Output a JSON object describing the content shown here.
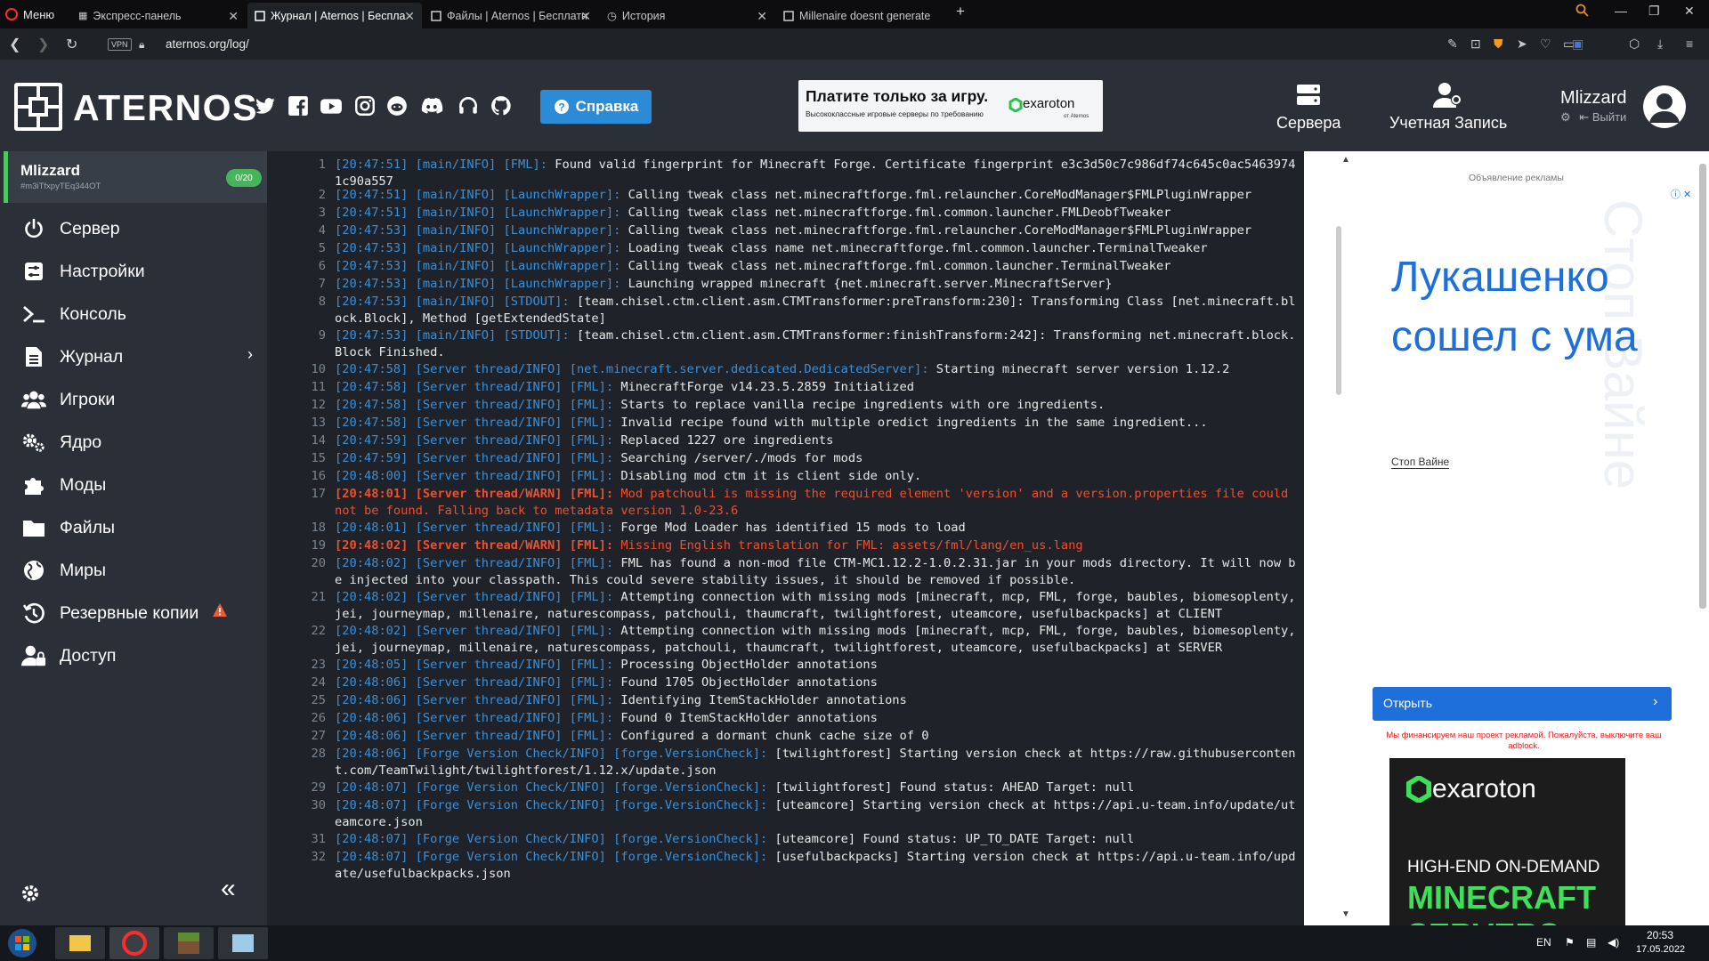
{
  "browser": {
    "menu_label": "Меню",
    "tabs": [
      {
        "label": "Экспресс-панель",
        "active": false
      },
      {
        "label": "Журнал | Aternos | Беспла",
        "active": true
      },
      {
        "label": "Файлы | Aternos | Бесплатн",
        "active": false
      },
      {
        "label": "История",
        "active": false
      },
      {
        "label": "Millenaire doesnt generate",
        "active": false
      }
    ],
    "vpn_label": "VPN",
    "url": "aternos.org/log/"
  },
  "header": {
    "logo_text": "ATERNOS",
    "help_label": "Справка",
    "promo": {
      "headline": "Платите только за игру.",
      "subline": "Высококлассные игровые серверы по требованию",
      "brand": "exaroton",
      "brand_sub": "от Aternos"
    },
    "nav": [
      {
        "label": "Сервера",
        "icon": "servers-icon"
      },
      {
        "label": "Учетная Запись",
        "icon": "account-icon"
      }
    ],
    "user": {
      "name": "Mlizzard",
      "logout": "Выйти"
    }
  },
  "sidebar": {
    "server_name": "Mlizzard",
    "server_id": "#m3iTfxpyTEq344OT",
    "players_badge": "0/20",
    "items": [
      {
        "label": "Сервер",
        "icon": "power-icon"
      },
      {
        "label": "Настройки",
        "icon": "sliders-icon"
      },
      {
        "label": "Консоль",
        "icon": "terminal-icon"
      },
      {
        "label": "Журнал",
        "icon": "document-icon"
      },
      {
        "label": "Игроки",
        "icon": "users-icon"
      },
      {
        "label": "Ядро",
        "icon": "cogs-icon"
      },
      {
        "label": "Моды",
        "icon": "puzzle-icon"
      },
      {
        "label": "Файлы",
        "icon": "folder-icon"
      },
      {
        "label": "Миры",
        "icon": "globe-icon"
      },
      {
        "label": "Резервные копии",
        "icon": "history-icon"
      },
      {
        "label": "Доступ",
        "icon": "user-lock-icon"
      }
    ]
  },
  "log": {
    "lines": [
      {
        "n": "1",
        "p": "[20:47:51] [main/INFO] [FML]:",
        "m": "Found valid fingerprint for Minecraft Forge. Certificate fingerprint e3c3d50c7c986df74c645c0ac54639741c90a557",
        "warn": false
      },
      {
        "n": "2",
        "p": "[20:47:51] [main/INFO] [LaunchWrapper]:",
        "m": "Calling tweak class net.minecraftforge.fml.relauncher.CoreModManager$FMLPluginWrapper",
        "warn": false
      },
      {
        "n": "3",
        "p": "[20:47:51] [main/INFO] [LaunchWrapper]:",
        "m": "Calling tweak class net.minecraftforge.fml.common.launcher.FMLDeobfTweaker",
        "warn": false
      },
      {
        "n": "4",
        "p": "[20:47:53] [main/INFO] [LaunchWrapper]:",
        "m": "Calling tweak class net.minecraftforge.fml.relauncher.CoreModManager$FMLPluginWrapper",
        "warn": false
      },
      {
        "n": "5",
        "p": "[20:47:53] [main/INFO] [LaunchWrapper]:",
        "m": "Loading tweak class name net.minecraftforge.fml.common.launcher.TerminalTweaker",
        "warn": false
      },
      {
        "n": "6",
        "p": "[20:47:53] [main/INFO] [LaunchWrapper]:",
        "m": "Calling tweak class net.minecraftforge.fml.common.launcher.TerminalTweaker",
        "warn": false
      },
      {
        "n": "7",
        "p": "[20:47:53] [main/INFO] [LaunchWrapper]:",
        "m": "Launching wrapped minecraft {net.minecraft.server.MinecraftServer}",
        "warn": false
      },
      {
        "n": "8",
        "p": "[20:47:53] [main/INFO] [STDOUT]:",
        "m": "[team.chisel.ctm.client.asm.CTMTransformer:preTransform:230]: Transforming Class [net.minecraft.block.Block], Method [getExtendedState]",
        "warn": false
      },
      {
        "n": "9",
        "p": "[20:47:53] [main/INFO] [STDOUT]:",
        "m": "[team.chisel.ctm.client.asm.CTMTransformer:finishTransform:242]: Transforming net.minecraft.block.Block Finished.",
        "warn": false
      },
      {
        "n": "10",
        "p": "[20:47:58] [Server thread/INFO] [net.minecraft.server.dedicated.DedicatedServer]:",
        "m": "Starting minecraft server version 1.12.2",
        "warn": false
      },
      {
        "n": "11",
        "p": "[20:47:58] [Server thread/INFO] [FML]:",
        "m": "MinecraftForge v14.23.5.2859 Initialized",
        "warn": false
      },
      {
        "n": "12",
        "p": "[20:47:58] [Server thread/INFO] [FML]:",
        "m": "Starts to replace vanilla recipe ingredients with ore ingredients.",
        "warn": false
      },
      {
        "n": "13",
        "p": "[20:47:58] [Server thread/INFO] [FML]:",
        "m": "Invalid recipe found with multiple oredict ingredients in the same ingredient...",
        "warn": false
      },
      {
        "n": "14",
        "p": "[20:47:59] [Server thread/INFO] [FML]:",
        "m": "Replaced 1227 ore ingredients",
        "warn": false
      },
      {
        "n": "15",
        "p": "[20:47:59] [Server thread/INFO] [FML]:",
        "m": "Searching /server/./mods for mods",
        "warn": false
      },
      {
        "n": "16",
        "p": "[20:48:00] [Server thread/INFO] [FML]:",
        "m": "Disabling mod ctm it is client side only.",
        "warn": false
      },
      {
        "n": "17",
        "p": "[20:48:01] [Server thread/WARN] [FML]:",
        "m": "Mod patchouli is missing the required element 'version' and a version.properties file could not be found. Falling back to metadata version 1.0-23.6",
        "warn": true
      },
      {
        "n": "18",
        "p": "[20:48:01] [Server thread/INFO] [FML]:",
        "m": "Forge Mod Loader has identified 15 mods to load",
        "warn": false
      },
      {
        "n": "19",
        "p": "[20:48:02] [Server thread/WARN] [FML]:",
        "m": "Missing English translation for FML: assets/fml/lang/en_us.lang",
        "warn": true
      },
      {
        "n": "20",
        "p": "[20:48:02] [Server thread/INFO] [FML]:",
        "m": "FML has found a non-mod file CTM-MC1.12.2-1.0.2.31.jar in your mods directory. It will now be injected into your classpath. This could severe stability issues, it should be removed if possible.",
        "warn": false
      },
      {
        "n": "21",
        "p": "[20:48:02] [Server thread/INFO] [FML]:",
        "m": "Attempting connection with missing mods [minecraft, mcp, FML, forge, baubles, biomesoplenty, jei, journeymap, millenaire, naturescompass, patchouli, thaumcraft, twilightforest, uteamcore, usefulbackpacks] at CLIENT",
        "warn": false
      },
      {
        "n": "22",
        "p": "[20:48:02] [Server thread/INFO] [FML]:",
        "m": "Attempting connection with missing mods [minecraft, mcp, FML, forge, baubles, biomesoplenty, jei, journeymap, millenaire, naturescompass, patchouli, thaumcraft, twilightforest, uteamcore, usefulbackpacks] at SERVER",
        "warn": false
      },
      {
        "n": "23",
        "p": "[20:48:05] [Server thread/INFO] [FML]:",
        "m": "Processing ObjectHolder annotations",
        "warn": false
      },
      {
        "n": "24",
        "p": "[20:48:06] [Server thread/INFO] [FML]:",
        "m": "Found 1705 ObjectHolder annotations",
        "warn": false
      },
      {
        "n": "25",
        "p": "[20:48:06] [Server thread/INFO] [FML]:",
        "m": "Identifying ItemStackHolder annotations",
        "warn": false
      },
      {
        "n": "26",
        "p": "[20:48:06] [Server thread/INFO] [FML]:",
        "m": "Found 0 ItemStackHolder annotations",
        "warn": false
      },
      {
        "n": "27",
        "p": "[20:48:06] [Server thread/INFO] [FML]:",
        "m": "Configured a dormant chunk cache size of 0",
        "warn": false
      },
      {
        "n": "28",
        "p": "[20:48:06] [Forge Version Check/INFO] [forge.VersionCheck]:",
        "m": "[twilightforest] Starting version check at https://raw.githubusercontent.com/TeamTwilight/twilightforest/1.12.x/update.json",
        "warn": false
      },
      {
        "n": "29",
        "p": "[20:48:07] [Forge Version Check/INFO] [forge.VersionCheck]:",
        "m": "[twilightforest] Found status: AHEAD Target: null",
        "warn": false
      },
      {
        "n": "30",
        "p": "[20:48:07] [Forge Version Check/INFO] [forge.VersionCheck]:",
        "m": "[uteamcore] Starting version check at https://api.u-team.info/update/uteamcore.json",
        "warn": false
      },
      {
        "n": "31",
        "p": "[20:48:07] [Forge Version Check/INFO] [forge.VersionCheck]:",
        "m": "[uteamcore] Found status: UP_TO_DATE Target: null",
        "warn": false
      },
      {
        "n": "32",
        "p": "[20:48:07] [Forge Version Check/INFO] [forge.VersionCheck]:",
        "m": "[usefulbackpacks] Starting version check at https://api.u-team.info/update/usefulbackpacks.json",
        "warn": false
      }
    ]
  },
  "ads": {
    "label": "Объявление рекламы",
    "headline": "Лукашенко сошел с ума",
    "bg_text": "Стоп Вайне",
    "link": "Стоп Вайне",
    "button": "Открыть",
    "note": "Мы финансируем наш проект рекламой. Пожалуйста, выключите ваш adblock.",
    "banner_brand": "exaroton",
    "banner_line1": "HIGH-END ON-DEMAND",
    "banner_line2": "MINECRAFT SERVERS"
  },
  "taskbar": {
    "lang": "EN",
    "time": "20:53",
    "date": "17.05.2022"
  },
  "colors": {
    "accent": "#2b8bd6",
    "green": "#4fc660",
    "warn": "#ef4f2f",
    "link": "#3d8fd6"
  }
}
